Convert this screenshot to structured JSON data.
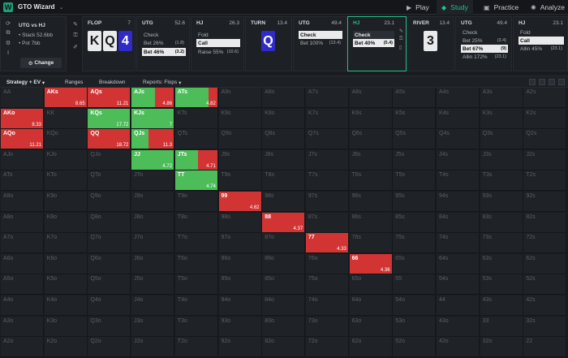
{
  "app": {
    "name": "GTO Wizard"
  },
  "nav": [
    {
      "label": "Play",
      "icon": "play-icon"
    },
    {
      "label": "Study",
      "icon": "study-icon"
    },
    {
      "label": "Practice",
      "icon": "practice-icon"
    },
    {
      "label": "Analyze",
      "icon": "analyze-icon"
    }
  ],
  "info": {
    "matchup": "UTG vs HJ",
    "stack": "• Stack 52.6bb",
    "pot": "• Pot 7bb",
    "change": "Change"
  },
  "stages": [
    {
      "name": "FLOP",
      "num": "7",
      "cards": [
        "K",
        "Q",
        "4"
      ]
    },
    {
      "name": "UTG",
      "num": "52.6",
      "actions": [
        {
          "label": "Check",
          "freq": "",
          "size": ""
        },
        {
          "label": "Bet 26%",
          "freq": "",
          "size": "(1.8)"
        },
        {
          "label": "Bet 46%",
          "freq": "",
          "size": "(3.2)"
        }
      ]
    },
    {
      "name": "HJ",
      "num": "26.3",
      "actions": [
        {
          "label": "Fold",
          "size": ""
        },
        {
          "label": "Call",
          "size": ""
        },
        {
          "label": "Raise 55%",
          "size": "(10.6)"
        }
      ]
    },
    {
      "name": "TURN",
      "num": "13.4",
      "cards": [
        "Q"
      ]
    },
    {
      "name": "UTG",
      "num": "49.4",
      "actions": [
        {
          "label": "Check",
          "size": ""
        },
        {
          "label": "Bet 100%",
          "size": "(13.4)"
        }
      ]
    },
    {
      "name": "HJ",
      "num": "23.1",
      "actions": [
        {
          "label": "Check",
          "size": ""
        },
        {
          "label": "Bet 40%",
          "size": "(5.4)"
        }
      ]
    },
    {
      "name": "RIVER",
      "num": "13.4",
      "cards": [
        "3"
      ]
    },
    {
      "name": "UTG",
      "num": "49.4",
      "actions": [
        {
          "label": "Check",
          "size": ""
        },
        {
          "label": "Bet 25%",
          "size": "(3.4)"
        },
        {
          "label": "Bet 67%",
          "size": "(9)"
        },
        {
          "label": "Allin 172%",
          "size": "(23.1)"
        }
      ]
    },
    {
      "name": "HJ",
      "num": "23.1",
      "actions": [
        {
          "label": "Fold",
          "size": ""
        },
        {
          "label": "Call",
          "size": ""
        },
        {
          "label": "Allin 45%",
          "size": "(23.1)"
        }
      ]
    }
  ],
  "toolbar": {
    "strategy": "Strategy + EV",
    "ranges": "Ranges",
    "breakdown": "Breakdown",
    "reports": "Reports: Flops"
  },
  "ranks": [
    "A",
    "K",
    "Q",
    "J",
    "T",
    "9",
    "8",
    "7",
    "6",
    "5",
    "4",
    "3",
    "2"
  ],
  "colors": {
    "green": "#4dbd5a",
    "red": "#d23434",
    "accent": "#22c28a"
  },
  "hands": {
    "AKs": {
      "green": 0.0,
      "ev": "8.65"
    },
    "AQs": {
      "green": 0.0,
      "ev": "11.21"
    },
    "AJs": {
      "green": 0.55,
      "ev": "4.86"
    },
    "ATs": {
      "green": 0.8,
      "ev": "4.82"
    },
    "AKo": {
      "green": 0.0,
      "ev": "8.33"
    },
    "KQs": {
      "green": 1.0,
      "ev": "17.72"
    },
    "KJs": {
      "green": 1.0,
      "ev": "7"
    },
    "AQo": {
      "green": 0.0,
      "ev": "11.21"
    },
    "QQ": {
      "green": 0.0,
      "ev": "18.72"
    },
    "QJs": {
      "green": 0.4,
      "ev": "11.3"
    },
    "JJ": {
      "green": 1.0,
      "ev": "4.72"
    },
    "JTs": {
      "green": 0.55,
      "ev": "4.71"
    },
    "TT": {
      "green": 1.0,
      "ev": "4.74"
    },
    "99": {
      "green": 0.0,
      "ev": "4.62"
    },
    "88": {
      "green": 0.0,
      "ev": "4.37"
    },
    "77": {
      "green": 0.0,
      "ev": "4.33"
    },
    "66": {
      "green": 0.0,
      "ev": "4.36"
    }
  }
}
